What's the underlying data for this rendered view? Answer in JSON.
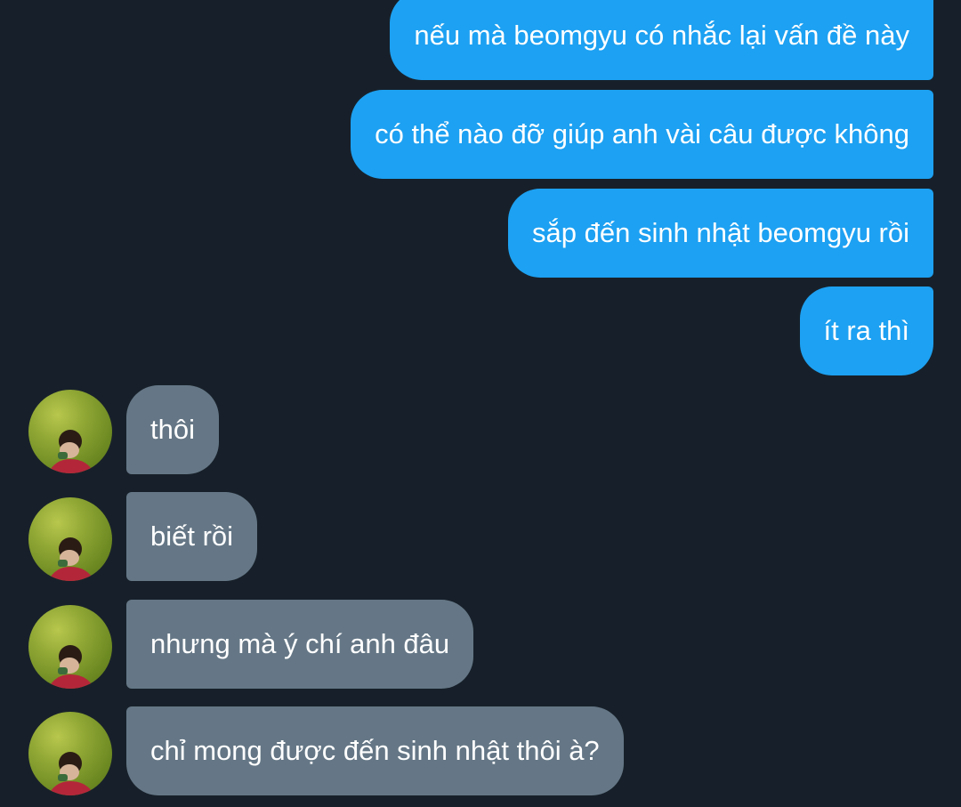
{
  "conversation": {
    "sent_messages": [
      {
        "text": "nếu mà beomgyu có nhắc lại vấn đề này"
      },
      {
        "text": "có thể nào đỡ giúp anh vài câu được không"
      },
      {
        "text": "sắp đến sinh nhật beomgyu rồi"
      },
      {
        "text": "ít ra thì"
      }
    ],
    "received_messages": [
      {
        "text": "thôi"
      },
      {
        "text": "biết rồi"
      },
      {
        "text": "nhưng mà ý chí anh đâu"
      },
      {
        "text": "chỉ mong được đến sinh nhật thôi à?"
      }
    ]
  },
  "colors": {
    "background": "#17202a",
    "sent_bubble": "#1da1f2",
    "received_bubble": "#657786",
    "text": "#ffffff"
  },
  "icons": {
    "avatar": "user-avatar-photo"
  }
}
